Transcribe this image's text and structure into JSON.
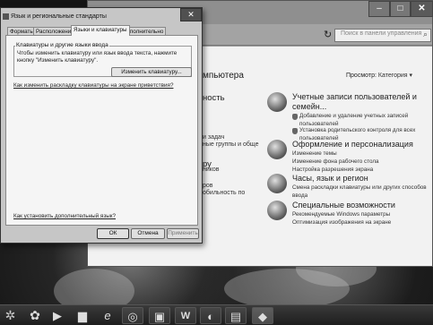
{
  "control_panel": {
    "search_placeholder": "Поиск в панели управления",
    "heading_fragment": "мпьютера",
    "view_label": "Просмотр:",
    "view_value": "Категория ▾",
    "left_fragments": [
      "ность",
      "и задач",
      "ные группы и обще",
      "ру",
      "ников",
      "ров",
      "обильность по"
    ],
    "categories": [
      {
        "title": "Учетные записи пользователей и семейн...",
        "subs": [
          "Добавление и удаление учетных записей пользователей",
          "Установка родительского контроля для всех пользователей"
        ]
      },
      {
        "title": "Оформление и персонализация",
        "subs": [
          "Изменение темы",
          "Изменение фона рабочего стола",
          "Настройка разрешения экрана"
        ]
      },
      {
        "title": "Часы, язык и регион",
        "subs": [
          "Смена раскладки клавиатуры или других способов ввода"
        ]
      },
      {
        "title": "Специальные возможности",
        "subs": [
          "Рекомендуемые Windows параметры",
          "Оптимизация изображения на экране"
        ]
      }
    ]
  },
  "dialog": {
    "title": "Язык и региональные стандарты",
    "tabs": [
      "Форматы",
      "Расположение",
      "Языки и клавиатуры",
      "Дополнительно"
    ],
    "active_tab": 2,
    "group_title": "Клавиатуры и другие языки ввода",
    "group_text": "Чтобы изменить клавиатуру или язык ввода текста, нажмите кнопку \"Изменить клавиатуру\".",
    "change_keyboard_button": "Изменить клавиатуру...",
    "hotkey_link": "Как изменить раскладку клавиатуры на экране приветствия?",
    "more_languages_link": "Как установить дополнительный язык?",
    "ok": "ОК",
    "cancel": "Отмена",
    "apply": "Применить"
  },
  "window_buttons": {
    "minimize": "–",
    "maximize": "□",
    "close": "✕"
  },
  "taskbar": {
    "items": [
      {
        "name": "taskbar-media-player-icon",
        "glyph": "▶"
      },
      {
        "name": "taskbar-folder-icon",
        "glyph": "▆"
      },
      {
        "name": "taskbar-ie-icon",
        "glyph": "e"
      },
      {
        "name": "taskbar-chrome-icon",
        "glyph": "◎"
      },
      {
        "name": "taskbar-app-icon",
        "glyph": "▣"
      },
      {
        "name": "taskbar-word-icon",
        "glyph": "W"
      },
      {
        "name": "taskbar-paint-icon",
        "glyph": "◐"
      },
      {
        "name": "taskbar-app2-icon",
        "glyph": "▤"
      },
      {
        "name": "taskbar-control-panel-icon",
        "glyph": "◆"
      }
    ]
  }
}
